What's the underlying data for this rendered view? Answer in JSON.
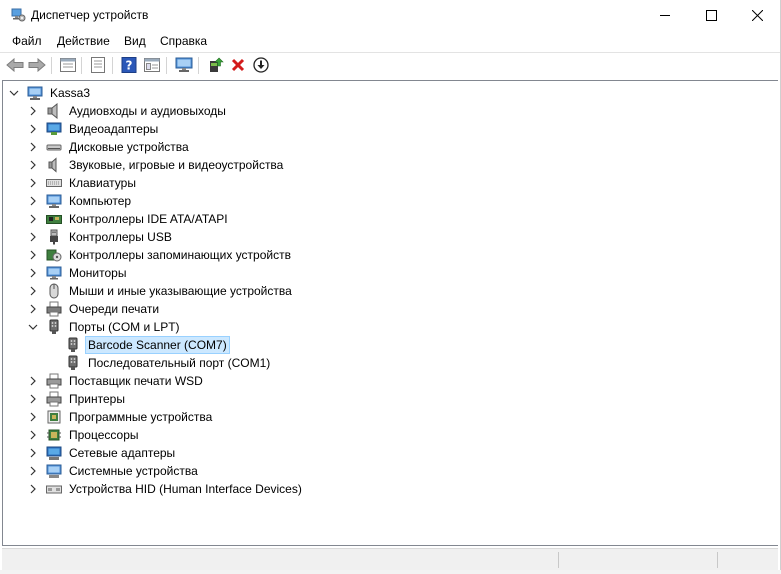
{
  "window": {
    "title": "Диспетчер устройств"
  },
  "menu": [
    "Файл",
    "Действие",
    "Вид",
    "Справка"
  ],
  "toolbar": {
    "buttons": [
      "back-arrow-icon",
      "forward-arrow-icon",
      "properties-view-icon",
      "show-hidden-icon",
      "help-icon",
      "action-view-icon",
      "monitor-scan-icon",
      "update-driver-icon",
      "uninstall-device-icon",
      "disable-device-icon"
    ]
  },
  "tree": {
    "root": "Kassa3",
    "categories": [
      {
        "label": "Аудиовходы и аудиовыходы",
        "icon": "speaker-icon"
      },
      {
        "label": "Видеоадаптеры",
        "icon": "display-adapter-icon"
      },
      {
        "label": "Дисковые устройства",
        "icon": "disk-drive-icon"
      },
      {
        "label": "Звуковые, игровые и видеоустройства",
        "icon": "sound-icon"
      },
      {
        "label": "Клавиатуры",
        "icon": "keyboard-icon"
      },
      {
        "label": "Компьютер",
        "icon": "computer-icon"
      },
      {
        "label": "Контроллеры IDE ATA/ATAPI",
        "icon": "ide-controller-icon"
      },
      {
        "label": "Контроллеры USB",
        "icon": "usb-icon"
      },
      {
        "label": "Контроллеры запоминающих устройств",
        "icon": "storage-controller-icon"
      },
      {
        "label": "Мониторы",
        "icon": "monitor-icon"
      },
      {
        "label": "Мыши и иные указывающие устройства",
        "icon": "mouse-icon"
      },
      {
        "label": "Очереди печати",
        "icon": "print-queue-icon"
      },
      {
        "label": "Порты (COM и LPT)",
        "icon": "port-icon",
        "expanded": true,
        "children": [
          {
            "label": "Barcode Scanner (COM7)",
            "icon": "port-icon",
            "selected": true
          },
          {
            "label": "Последовательный порт (COM1)",
            "icon": "port-icon"
          }
        ]
      },
      {
        "label": "Поставщик печати WSD",
        "icon": "printer-icon"
      },
      {
        "label": "Принтеры",
        "icon": "printer-icon"
      },
      {
        "label": "Программные устройства",
        "icon": "software-device-icon"
      },
      {
        "label": "Процессоры",
        "icon": "processor-icon"
      },
      {
        "label": "Сетевые адаптеры",
        "icon": "network-adapter-icon"
      },
      {
        "label": "Системные устройства",
        "icon": "system-device-icon"
      },
      {
        "label": "Устройства HID (Human Interface Devices)",
        "icon": "hid-icon"
      }
    ]
  },
  "colors": {
    "selection_bg": "#cce8ff",
    "selection_border": "#99d1ff",
    "accent_blue": "#1f5fbf",
    "uninstall_red": "#d31b1b"
  }
}
